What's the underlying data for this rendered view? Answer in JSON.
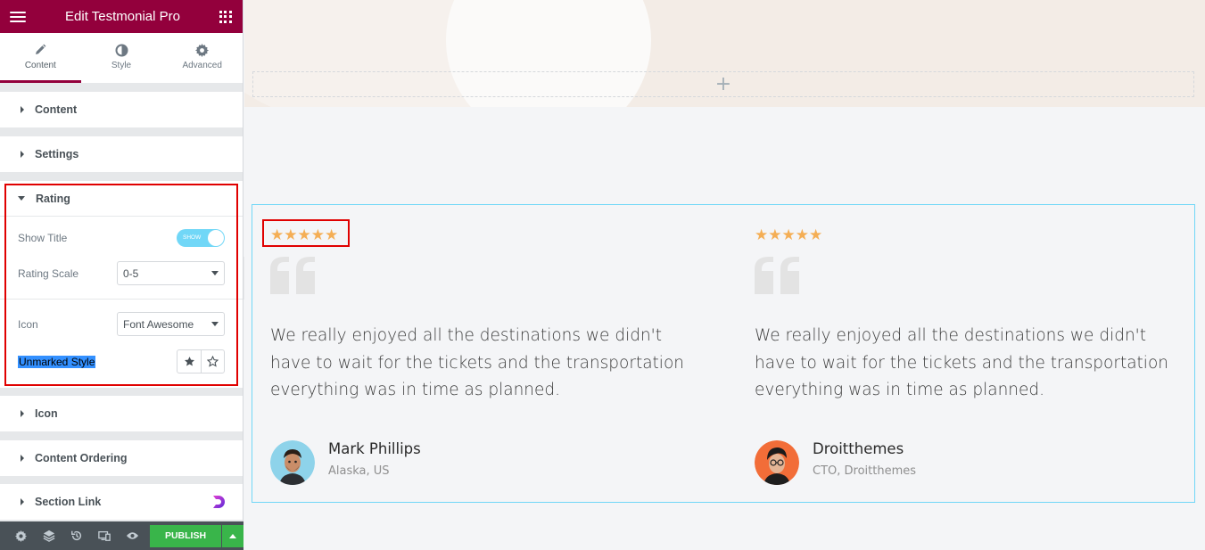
{
  "header": {
    "title": "Edit Testmonial Pro"
  },
  "tabs": [
    {
      "label": "Content",
      "icon": "pencil-icon"
    },
    {
      "label": "Style",
      "icon": "half-circle-icon"
    },
    {
      "label": "Advanced",
      "icon": "gear-icon"
    }
  ],
  "sections": {
    "content": "Content",
    "settings": "Settings",
    "rating": "Rating",
    "icon": "Icon",
    "content_ordering": "Content Ordering",
    "section_link": "Section Link"
  },
  "rating_controls": {
    "show_title_label": "Show Title",
    "show_title_toggle": "SHOW",
    "show_title_on": true,
    "rating_scale_label": "Rating Scale",
    "rating_scale_value": "0-5",
    "icon_label": "Icon",
    "icon_value": "Font Awesome",
    "unmarked_style_label": "Unmarked Style"
  },
  "footer": {
    "publish_label": "PUBLISH"
  },
  "testimonials": [
    {
      "rating": 5,
      "stars": "★★★★★",
      "text": "We really enjoyed all the destinations we didn't have to wait for the tickets and the transportation everything was in time as planned.",
      "name": "Mark Phillips",
      "designation": "Alaska, US"
    },
    {
      "rating": 5,
      "stars": "★★★★★",
      "text": "We really enjoyed all the destinations we didn't have to wait for the tickets and the transportation everything was in time as planned.",
      "name": "Droitthemes",
      "designation": "CTO, Droitthemes"
    }
  ],
  "colors": {
    "brand": "#93003c",
    "star": "#f4ae55",
    "publish": "#39b54a",
    "highlight_box": "#e00000",
    "widget_border": "#71d7f7"
  }
}
